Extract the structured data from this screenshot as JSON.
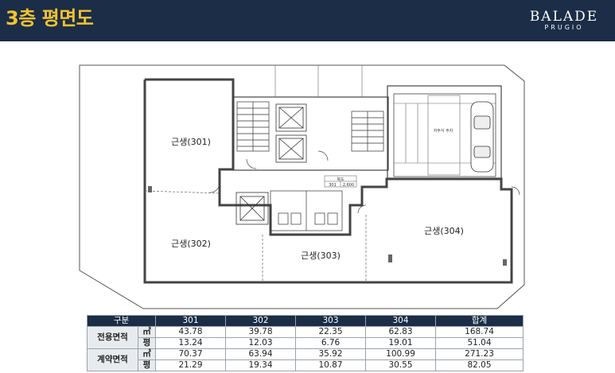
{
  "header": {
    "title": "3층 평면도",
    "brand_main": "BALADE",
    "brand_sub": "PRUGIO"
  },
  "plan": {
    "rooms": [
      "근생(301)",
      "근생(302)",
      "근생(303)",
      "근생(304)"
    ],
    "parking_label": "자주식 주차",
    "table_labels": [
      "복도",
      "301",
      "2,600"
    ]
  },
  "area_table": {
    "headers": [
      "구분",
      "301",
      "302",
      "303",
      "304",
      "합계"
    ],
    "groups": [
      {
        "label": "전용면적",
        "rows": [
          {
            "unit": "㎡",
            "values": [
              "43.78",
              "39.78",
              "22.35",
              "62.83",
              "168.74"
            ]
          },
          {
            "unit": "평",
            "values": [
              "13.24",
              "12.03",
              "6.76",
              "19.01",
              "51.04"
            ]
          }
        ]
      },
      {
        "label": "계약면적",
        "rows": [
          {
            "unit": "㎡",
            "values": [
              "70.37",
              "63.94",
              "35.92",
              "100.99",
              "271.23"
            ]
          },
          {
            "unit": "평",
            "values": [
              "21.29",
              "19.34",
              "10.87",
              "30.55",
              "82.05"
            ]
          }
        ]
      }
    ]
  },
  "colors": {
    "header_bg": "#1b2d47",
    "title_color": "#f2c230",
    "table_header_bg": "#1b2d47"
  }
}
